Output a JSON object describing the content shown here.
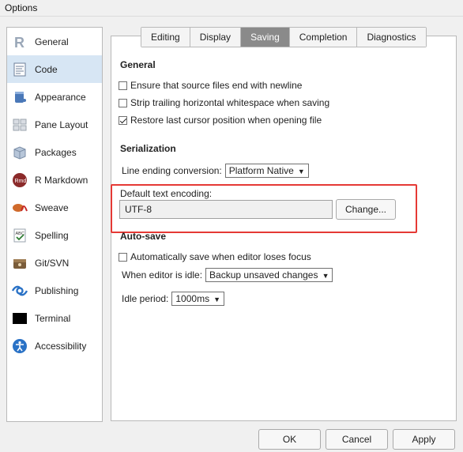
{
  "window": {
    "title": "Options"
  },
  "sidebar": {
    "items": [
      {
        "label": "General",
        "icon": "r-logo-icon"
      },
      {
        "label": "Code",
        "icon": "code-file-icon"
      },
      {
        "label": "Appearance",
        "icon": "paint-bucket-icon"
      },
      {
        "label": "Pane Layout",
        "icon": "pane-layout-icon"
      },
      {
        "label": "Packages",
        "icon": "package-box-icon"
      },
      {
        "label": "R Markdown",
        "icon": "rmd-icon"
      },
      {
        "label": "Sweave",
        "icon": "sweave-pdf-icon"
      },
      {
        "label": "Spelling",
        "icon": "spellcheck-icon"
      },
      {
        "label": "Git/SVN",
        "icon": "git-svn-icon"
      },
      {
        "label": "Publishing",
        "icon": "publishing-icon"
      },
      {
        "label": "Terminal",
        "icon": "terminal-icon"
      },
      {
        "label": "Accessibility",
        "icon": "accessibility-icon"
      }
    ],
    "active": "Code"
  },
  "tabs": [
    "Editing",
    "Display",
    "Saving",
    "Completion",
    "Diagnostics"
  ],
  "active_tab": "Saving",
  "general": {
    "title": "General",
    "options": [
      {
        "label": "Ensure that source files end with newline",
        "checked": false
      },
      {
        "label": "Strip trailing horizontal whitespace when saving",
        "checked": false
      },
      {
        "label": "Restore last cursor position when opening file",
        "checked": true
      }
    ]
  },
  "serialization": {
    "title": "Serialization",
    "line_ending_label": "Line ending conversion:",
    "line_ending_value": "Platform Native",
    "encoding_label": "Default text encoding:",
    "encoding_value": "UTF-8",
    "change_button": "Change..."
  },
  "autosave": {
    "title": "Auto-save",
    "option_label": "Automatically save when editor loses focus",
    "option_checked": false,
    "idle_label": "When editor is idle:",
    "idle_value": "Backup unsaved changes",
    "period_label": "Idle period:",
    "period_value": "1000ms"
  },
  "footer": {
    "ok": "OK",
    "cancel": "Cancel",
    "apply": "Apply"
  },
  "colors": {
    "highlight_box": "#e53935",
    "active_item_bg": "#d7e6f4",
    "active_tab_bg": "#8a8a8a"
  }
}
